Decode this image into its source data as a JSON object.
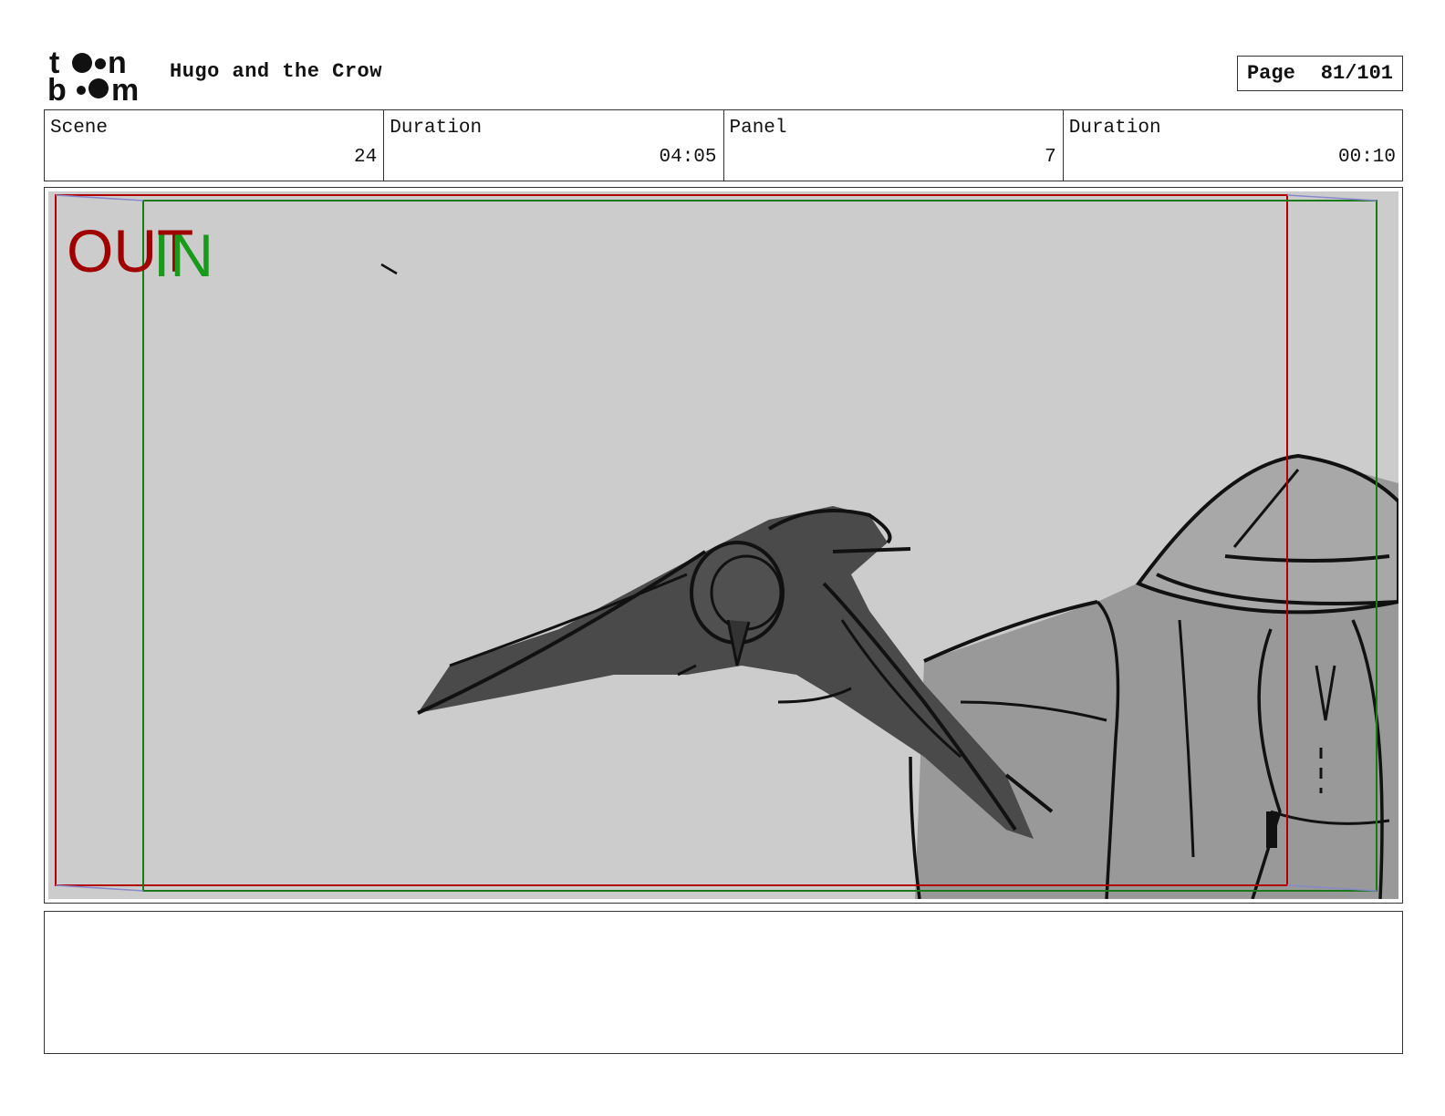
{
  "header": {
    "project_title": "Hugo and the Crow",
    "page_label": "Page",
    "page_number": "81/101",
    "logo_icon": "toonboom-logo"
  },
  "info": {
    "scene_label": "Scene",
    "scene_value": "24",
    "scene_duration_label": "Duration",
    "scene_duration_value": "04:05",
    "panel_label": "Panel",
    "panel_value": "7",
    "panel_duration_label": "Duration",
    "panel_duration_value": "00:10"
  },
  "panel": {
    "out_label": "OUT",
    "in_label": "IN",
    "out_color": "#a00000",
    "in_color": "#1a9a1a",
    "background_color": "#cccccc"
  },
  "notes": {}
}
